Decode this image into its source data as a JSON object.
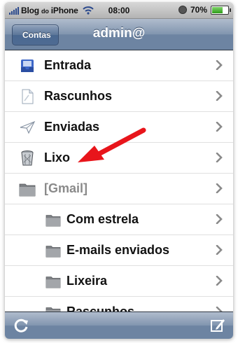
{
  "status_bar": {
    "carrier": "Blog",
    "carrier_small": "do",
    "carrier_suffix": "iPhone",
    "time": "08:00",
    "battery": "70%",
    "battery_level": 0.7
  },
  "navbar": {
    "back_label": "Contas",
    "title": "admin@"
  },
  "mailboxes": [
    {
      "label": "Entrada",
      "icon": "inbox-icon",
      "level": "top"
    },
    {
      "label": "Rascunhos",
      "icon": "drafts-icon",
      "level": "top"
    },
    {
      "label": "Enviadas",
      "icon": "sent-icon",
      "level": "top"
    },
    {
      "label": "Lixo",
      "icon": "trash-icon",
      "level": "top"
    },
    {
      "label": "[Gmail]",
      "icon": "folder-icon",
      "level": "top"
    },
    {
      "label": "Com estrela",
      "icon": "folder-icon",
      "level": "sub"
    },
    {
      "label": "E-mails enviados",
      "icon": "folder-icon",
      "level": "sub"
    },
    {
      "label": "Lixeira",
      "icon": "folder-icon",
      "level": "sub"
    },
    {
      "label": "Rascunhos",
      "icon": "folder-icon",
      "level": "sub"
    }
  ],
  "toolbar": {
    "refresh_icon": "refresh-icon",
    "compose_icon": "compose-icon"
  },
  "colors": {
    "navbar": "#6d84a2",
    "annotation_arrow": "#e8151b",
    "gray_label": "#8a8a8a"
  }
}
